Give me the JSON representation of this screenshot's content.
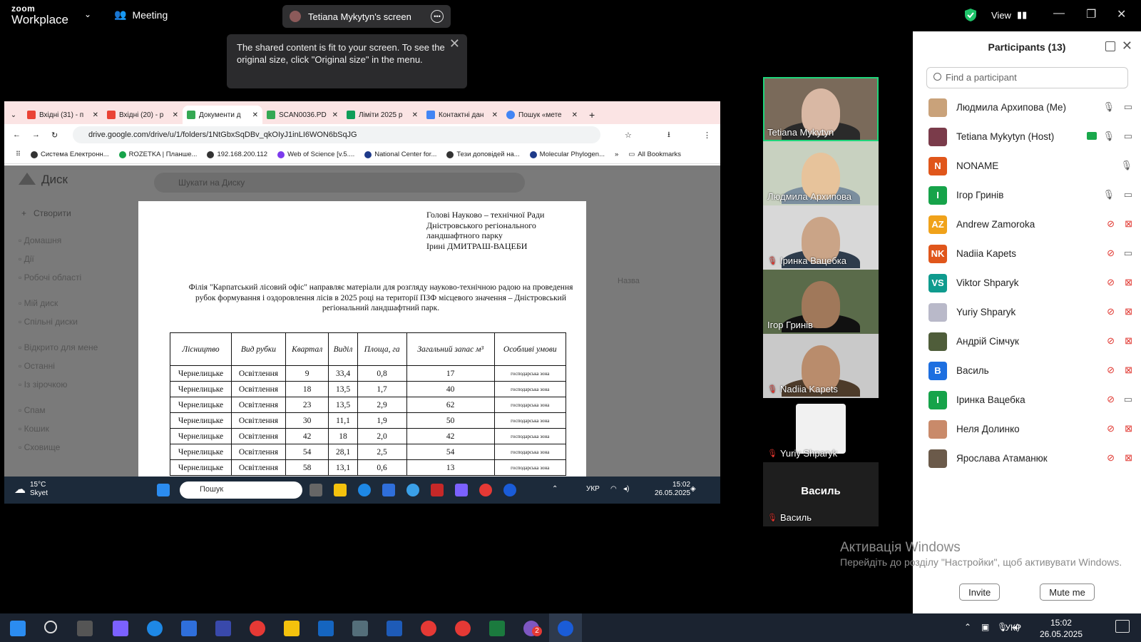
{
  "zoom": {
    "logo_top": "zoom",
    "logo_bottom": "Workplace",
    "meeting_label": "Meeting",
    "share_pill": "Tetiana Mykytyn's screen",
    "view_label": "View",
    "tooltip": "The shared content is fit to your screen. To see the original size, click \"Original size\" in the menu."
  },
  "browser": {
    "tabs": [
      "Вхідні (31) - п",
      "Вхідні (20) - р",
      "Документи д",
      "SCAN0036.PD",
      "Ліміти 2025 р",
      "Контактні дан",
      "Пошук «мете"
    ],
    "url": "drive.google.com/drive/u/1/folders/1NtGbxSqDBv_qkOIyJ1inLI6WON6bSqJG",
    "bookmarks": [
      "Система Електронн...",
      "ROZETKA | Планше...",
      "192.168.200.112",
      "Web of Science [v.5....",
      "National Center for...",
      "Тези доповідей на...",
      "Molecular Phylogen...",
      "All Bookmarks"
    ],
    "drive_title": "Диск",
    "drive_search": "Шукати на Диску",
    "drive_new": "Створити",
    "drive_nav": [
      "Домашня",
      "Дії",
      "Робочі області",
      "Мій диск",
      "Спільні диски",
      "Відкрито для мене",
      "Останні",
      "Із зірочкою",
      "Спам",
      "Кошик",
      "Сховище"
    ],
    "drive_list_header": "Назва"
  },
  "document": {
    "header_lines": [
      "Голові Науково – технічної Ради",
      "Дністровського регіонального",
      "ландшафтного парку",
      "Ірині ДМИТРАШ-ВАЦЕБИ"
    ],
    "paragraph": "Філія \"Карпатський лісовий офіс\" направляє матеріали для розгляду науково-технічною радою на проведення рубок формування і оздоровлення лісів в 2025 році на території ПЗФ місцевого значення – Дністровський регіональний ландшафтний парк.",
    "columns": [
      "Лісництво",
      "Вид рубки",
      "Квартал",
      "Виділ",
      "Площа, га",
      "Загальний запас м³",
      "Особливі умови"
    ],
    "rows": [
      [
        "Чернелицьке",
        "Освітлення",
        "9",
        "33,4",
        "0,8",
        "17",
        "господарська зона"
      ],
      [
        "Чернелицьке",
        "Освітлення",
        "18",
        "13,5",
        "1,7",
        "40",
        "господарська зона"
      ],
      [
        "Чернелицьке",
        "Освітлення",
        "23",
        "13,5",
        "2,9",
        "62",
        "господарська зона"
      ],
      [
        "Чернелицьке",
        "Освітлення",
        "30",
        "11,1",
        "1,9",
        "50",
        "господарська зона"
      ],
      [
        "Чернелицьке",
        "Освітлення",
        "42",
        "18",
        "2,0",
        "42",
        "господарська зона"
      ],
      [
        "Чернелицьке",
        "Освітлення",
        "54",
        "28,1",
        "2,5",
        "54",
        "господарська зона"
      ],
      [
        "Чернелицьке",
        "Освітлення",
        "58",
        "13,1",
        "0,6",
        "13",
        "господарська зона"
      ]
    ]
  },
  "shared_taskbar": {
    "weather_temp": "15°C",
    "weather_desc": "Skyet",
    "search": "Пошук",
    "lang": "УКР",
    "time": "15:02",
    "date": "26.05.2025"
  },
  "gallery": [
    {
      "name": "Tetiana Mykytyn",
      "muted": false,
      "speaking": true
    },
    {
      "name": "Людмила Архипова",
      "muted": false,
      "speaking": false
    },
    {
      "name": "Іринка Вацебка",
      "muted": true,
      "speaking": false
    },
    {
      "name": "Ігор Гринів",
      "muted": false,
      "speaking": false
    },
    {
      "name": "Nadiia Kapets",
      "muted": true,
      "speaking": false
    },
    {
      "name": "Yuriy Shparyk",
      "muted": true,
      "speaking": false
    },
    {
      "name": "Василь",
      "muted": true,
      "speaking": false,
      "center_label": "Василь"
    }
  ],
  "participants": {
    "title": "Participants (13)",
    "search_placeholder": "Find a participant",
    "list": [
      {
        "name": "Людмила Архипова (Me)",
        "avatar": "",
        "color": "#c9a27a",
        "mic": "on",
        "cam": "on"
      },
      {
        "name": "Tetiana Mykytyn (Host)",
        "avatar": "",
        "color": "#7a3b4a",
        "mic": "on",
        "cam": "on",
        "sharing": true
      },
      {
        "name": "NONAME",
        "avatar": "N",
        "color": "#e0561b",
        "mic": "on",
        "cam": "none"
      },
      {
        "name": "Ігор Гринів",
        "avatar": "I",
        "color": "#16a34a",
        "mic": "on",
        "cam": "on"
      },
      {
        "name": "Andrew Zamoroka",
        "avatar": "AZ",
        "color": "#f0a21a",
        "mic": "off",
        "cam": "off"
      },
      {
        "name": "Nadiia Kapets",
        "avatar": "NK",
        "color": "#e0561b",
        "mic": "off",
        "cam": "on"
      },
      {
        "name": "Viktor Shparyk",
        "avatar": "VS",
        "color": "#0f9b8e",
        "mic": "off",
        "cam": "off"
      },
      {
        "name": "Yuriy Shparyk",
        "avatar": "",
        "color": "#b9b9c9",
        "mic": "off",
        "cam": "off"
      },
      {
        "name": "Андрій Сімчук",
        "avatar": "",
        "color": "#4f5d3a",
        "mic": "off",
        "cam": "off"
      },
      {
        "name": "Василь",
        "avatar": "В",
        "color": "#1d6fe0",
        "mic": "off",
        "cam": "off"
      },
      {
        "name": "Іринка Вацебка",
        "avatar": "I",
        "color": "#16a34a",
        "mic": "off",
        "cam": "on"
      },
      {
        "name": "Неля Долинко",
        "avatar": "",
        "color": "#c98a6a",
        "mic": "off",
        "cam": "off"
      },
      {
        "name": "Ярослава Атаманюк",
        "avatar": "",
        "color": "#6b5a4a",
        "mic": "off",
        "cam": "off"
      }
    ],
    "invite": "Invite",
    "mute_me": "Mute me"
  },
  "activation": {
    "title": "Активація Windows",
    "body": "Перейдіть до розділу \"Настройки\", щоб активувати Windows."
  },
  "windows_taskbar": {
    "lang": "УКР",
    "time": "15:02",
    "date": "26.05.2025",
    "badge": "2"
  }
}
